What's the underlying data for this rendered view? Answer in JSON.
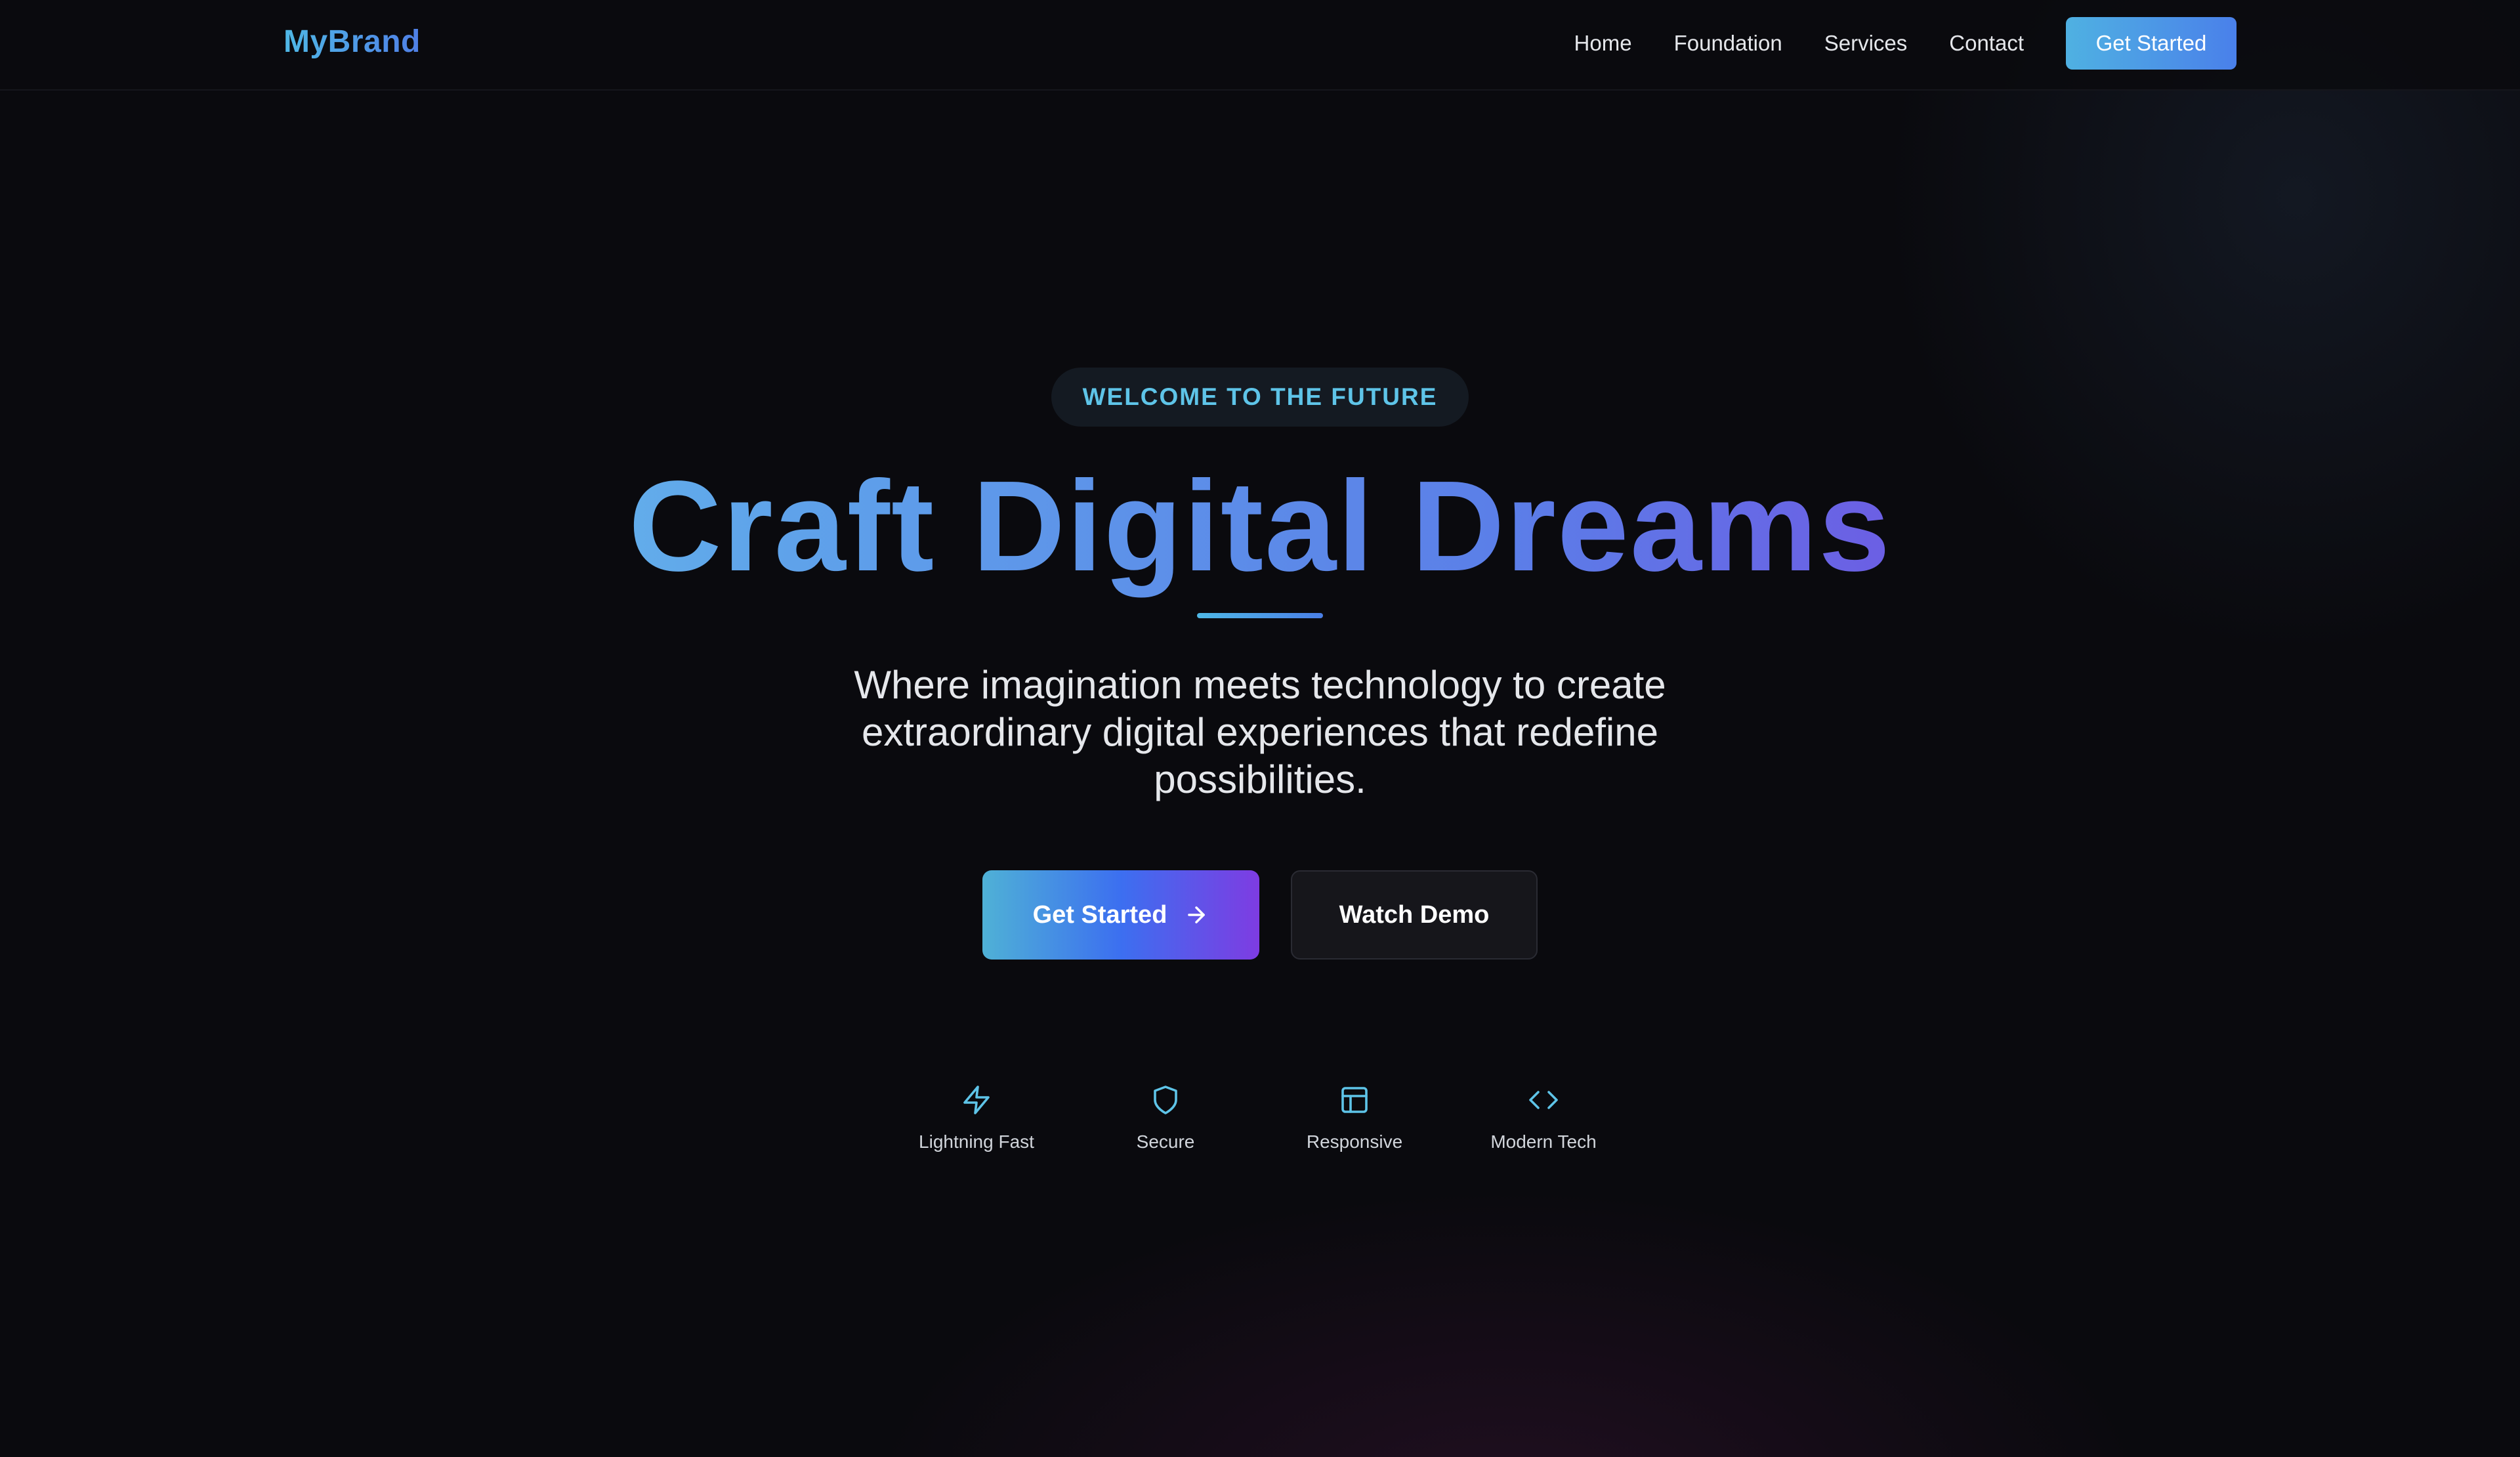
{
  "nav": {
    "brand": "MyBrand",
    "links": [
      "Home",
      "Foundation",
      "Services",
      "Contact"
    ],
    "cta_label": "Get Started"
  },
  "hero": {
    "badge": "WELCOME TO THE FUTURE",
    "headline": "Craft Digital Dreams",
    "subtitle": "Where imagination meets technology to create extraordinary digital experiences that redefine possibilities.",
    "primary_button": "Get Started",
    "secondary_button": "Watch Demo"
  },
  "features": [
    {
      "label": "Lightning Fast",
      "icon": "lightning-icon"
    },
    {
      "label": "Secure",
      "icon": "shield-icon"
    },
    {
      "label": "Responsive",
      "icon": "layout-icon"
    },
    {
      "label": "Modern Tech",
      "icon": "code-icon"
    }
  ],
  "colors": {
    "background": "#0a0a0e",
    "accent_cyan": "#5ec4e8",
    "accent_blue": "#4a80ea",
    "accent_purple": "#7e3ce2"
  }
}
